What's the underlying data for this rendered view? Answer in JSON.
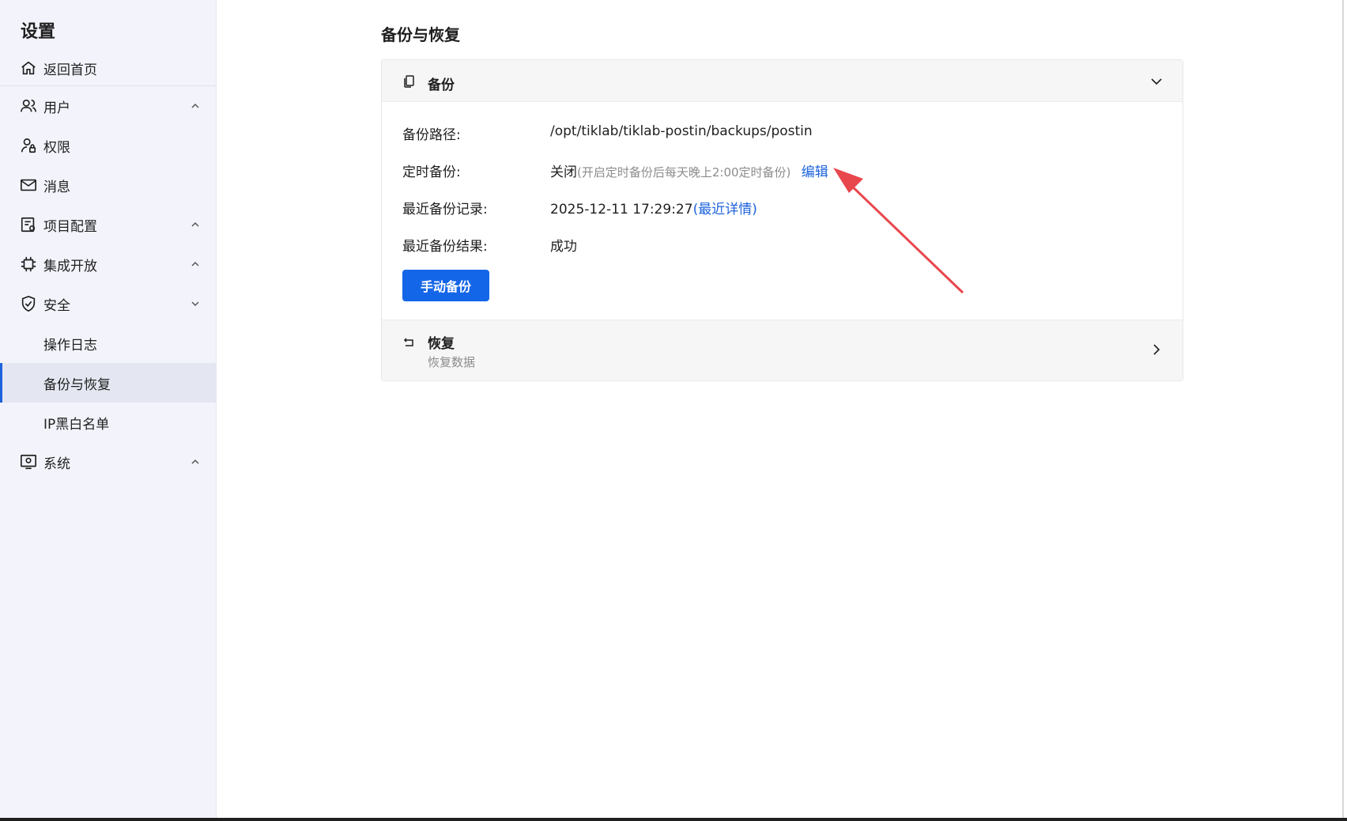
{
  "sidebar": {
    "title": "设置",
    "home_label": "返回首页",
    "items": [
      {
        "label": "用户",
        "icon": "users-icon",
        "chevron": "up"
      },
      {
        "label": "权限",
        "icon": "user-lock-icon"
      },
      {
        "label": "消息",
        "icon": "mail-icon"
      },
      {
        "label": "项目配置",
        "icon": "project-config-icon",
        "chevron": "up"
      },
      {
        "label": "集成开放",
        "icon": "chip-icon",
        "chevron": "up"
      },
      {
        "label": "安全",
        "icon": "shield-icon",
        "chevron": "down"
      },
      {
        "label": "操作日志"
      },
      {
        "label": "备份与恢复",
        "active": true
      },
      {
        "label": "IP黑白名单"
      },
      {
        "label": "系统",
        "icon": "monitor-icon",
        "chevron": "up"
      }
    ]
  },
  "main": {
    "page_title": "备份与恢复",
    "backup": {
      "title": "备份",
      "path_label": "备份路径:",
      "path_value": "/opt/tiklab/tiklab-postin/backups/postin",
      "schedule_label": "定时备份:",
      "schedule_state": "关闭",
      "schedule_hint": "(开启定时备份后每天晚上2:00定时备份)",
      "schedule_edit": "编辑",
      "last_record_label": "最近备份记录:",
      "last_record_time": "2025-12-11 17:29:27",
      "last_record_detail": "(最近详情)",
      "last_result_label": "最近备份结果:",
      "last_result_value": "成功",
      "manual_button": "手动备份"
    },
    "restore": {
      "title": "恢复",
      "subtitle": "恢复数据"
    }
  },
  "colors": {
    "accent": "#1466e8",
    "link": "#1d62dc",
    "annotation": "#e8474c",
    "sidebar_bg": "#f3f4fb"
  }
}
